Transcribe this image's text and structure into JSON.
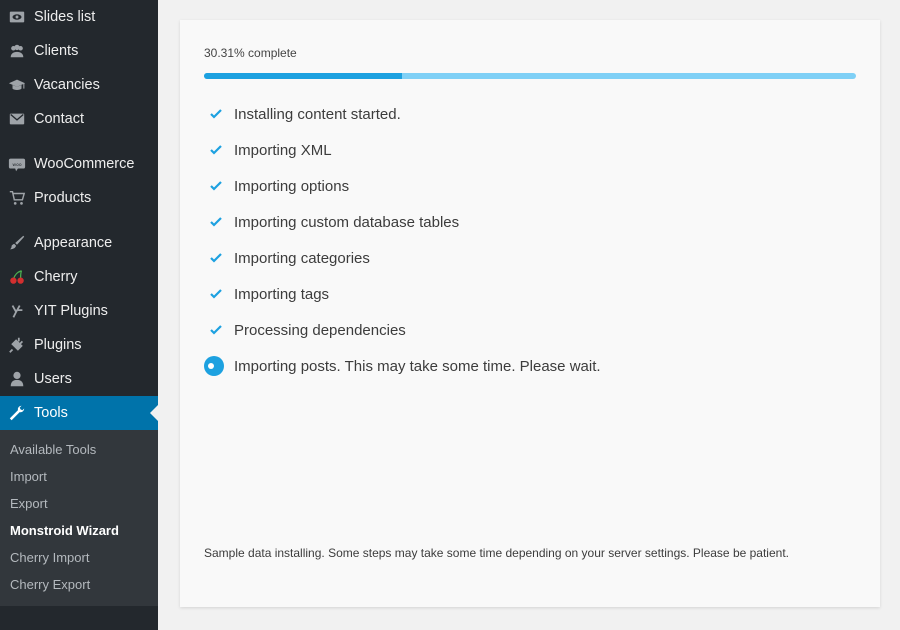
{
  "sidebar": {
    "items": [
      {
        "label": "Slides list",
        "icon": "eye-icon"
      },
      {
        "label": "Clients",
        "icon": "group-icon"
      },
      {
        "label": "Vacancies",
        "icon": "graduation-cap-icon"
      },
      {
        "label": "Contact",
        "icon": "envelope-icon"
      },
      {
        "label": "WooCommerce",
        "icon": "woo-icon"
      },
      {
        "label": "Products",
        "icon": "cart-icon"
      },
      {
        "label": "Appearance",
        "icon": "paintbrush-icon"
      },
      {
        "label": "Cherry",
        "icon": "cherry-icon"
      },
      {
        "label": "YIT Plugins",
        "icon": "yit-icon"
      },
      {
        "label": "Plugins",
        "icon": "plug-icon"
      },
      {
        "label": "Users",
        "icon": "user-icon"
      },
      {
        "label": "Tools",
        "icon": "wrench-icon",
        "active": true
      }
    ],
    "submenu": [
      {
        "label": "Available Tools"
      },
      {
        "label": "Import"
      },
      {
        "label": "Export"
      },
      {
        "label": "Monstroid Wizard",
        "current": true
      },
      {
        "label": "Cherry Import"
      },
      {
        "label": "Cherry Export"
      }
    ]
  },
  "main": {
    "progress_label": "30.31% complete",
    "progress_fraction": 0.3031,
    "steps": [
      {
        "text": "Installing content started.",
        "status": "done"
      },
      {
        "text": "Importing XML",
        "status": "done"
      },
      {
        "text": "Importing options",
        "status": "done"
      },
      {
        "text": "Importing custom database tables",
        "status": "done"
      },
      {
        "text": "Importing categories",
        "status": "done"
      },
      {
        "text": "Importing tags",
        "status": "done"
      },
      {
        "text": "Processing dependencies",
        "status": "done"
      },
      {
        "text": "Importing posts. This may take some time. Please wait.",
        "status": "in-progress"
      }
    ],
    "note": "Sample data installing. Some steps may take some time depending on your server settings. Please be patient."
  },
  "colors": {
    "sidebar_bg": "#23282d",
    "submenu_bg": "#32373c",
    "active_bg": "#0073aa",
    "accent": "#1da1e0",
    "progress_track": "#7fd0f6"
  }
}
